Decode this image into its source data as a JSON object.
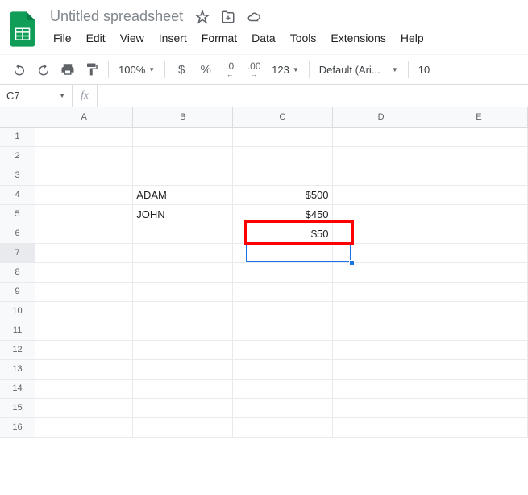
{
  "doc": {
    "title": "Untitled spreadsheet"
  },
  "menu": {
    "file": "File",
    "edit": "Edit",
    "view": "View",
    "insert": "Insert",
    "format": "Format",
    "data": "Data",
    "tools": "Tools",
    "extensions": "Extensions",
    "help": "Help"
  },
  "toolbar": {
    "zoom": "100%",
    "currency": "$",
    "percent": "%",
    "dec_dec": ".0",
    "inc_dec": ".00",
    "num_fmt": "123",
    "font": "Default (Ari...",
    "font_size": "10"
  },
  "formula": {
    "name_box": "C7",
    "fx": "fx",
    "input": ""
  },
  "cols": [
    "A",
    "B",
    "C",
    "D",
    "E"
  ],
  "rows": [
    "1",
    "2",
    "3",
    "4",
    "5",
    "6",
    "7",
    "8",
    "9",
    "10",
    "11",
    "12",
    "13",
    "14",
    "15",
    "16"
  ],
  "cells": {
    "B4": "ADAM",
    "C4": "$500",
    "B5": "JOHN",
    "C5": "$450",
    "C6": "$50"
  },
  "active_cell": "C7",
  "highlight_cell": "C6"
}
